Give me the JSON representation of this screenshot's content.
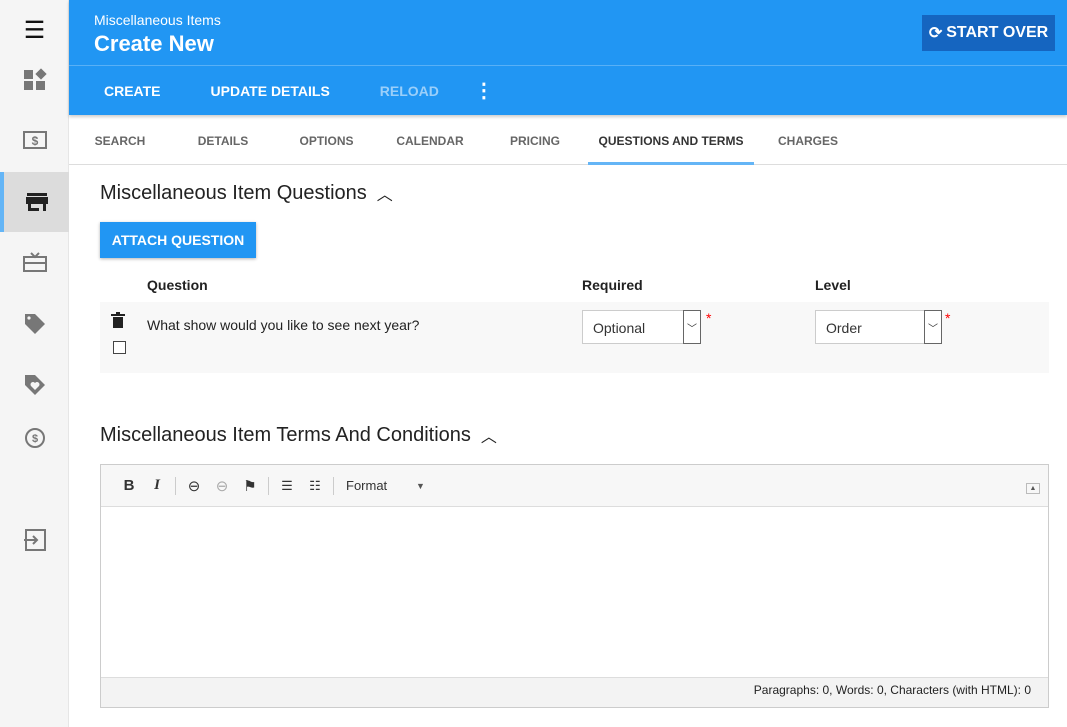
{
  "header": {
    "subtitle": "Miscellaneous Items",
    "title": "Create New",
    "start_over": "START OVER"
  },
  "actions": {
    "create": "CREATE",
    "update": "UPDATE DETAILS",
    "reload": "RELOAD",
    "more_icon": "more-vert-icon"
  },
  "tabs": [
    "SEARCH",
    "DETAILS",
    "OPTIONS",
    "CALENDAR",
    "PRICING",
    "QUESTIONS AND TERMS",
    "CHARGES"
  ],
  "active_tab": "QUESTIONS AND TERMS",
  "sidebar": [
    "menu-icon",
    "dashboard-icon",
    "money-icon",
    "store-icon",
    "gift-card-icon",
    "tag-icon",
    "tag-heart-icon",
    "currency-exchange-icon",
    "exit-icon"
  ],
  "questions": {
    "title": "Miscellaneous Item Questions",
    "attach": "ATTACH QUESTION",
    "col_question": "Question",
    "col_required": "Required",
    "col_level": "Level",
    "rows": [
      {
        "question": "What show would you like to see next year?",
        "required": "Optional",
        "level": "Order"
      }
    ]
  },
  "terms": {
    "title": "Miscellaneous Item Terms And Conditions",
    "format": "Format",
    "status": "Paragraphs: 0, Words: 0, Characters (with HTML): 0"
  },
  "colors": {
    "primary": "#2196f3",
    "dark": "#1565c0",
    "tab_indicator": "#64b5f6"
  }
}
